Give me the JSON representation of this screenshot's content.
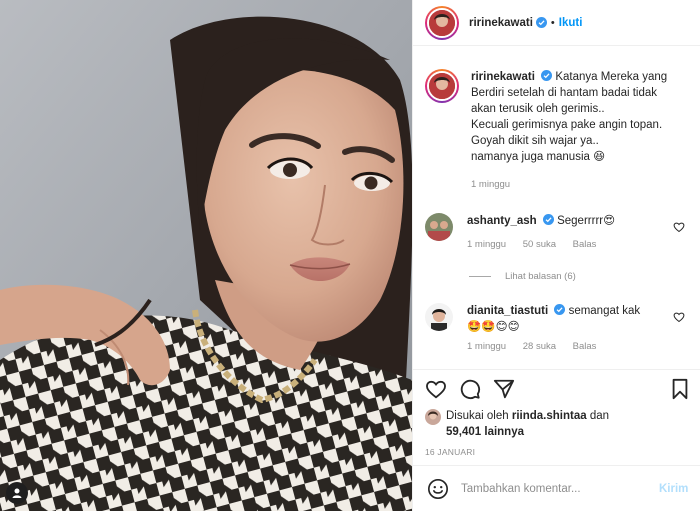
{
  "header": {
    "username": "ririnekawati",
    "separator": "•",
    "follow_label": "Ikuti"
  },
  "caption": {
    "username": "ririnekawati",
    "lines": [
      "Katanya Mereka yang",
      "Berdiri setelah di hantam badai tidak",
      "akan terusik oleh gerimis..",
      "Kecuali gerimisnya pake angin topan.",
      "Goyah dikit sih wajar ya..",
      "namanya juga manusia 😆"
    ],
    "time": "1 minggu"
  },
  "comments": [
    {
      "username": "ashanty_ash",
      "text": "Segerrrrr😍",
      "time": "1 minggu",
      "likes": "50 suka",
      "reply": "Balas",
      "view_replies": "Lihat balasan (6)"
    },
    {
      "username": "dianita_tiastuti",
      "text": "semangat kak",
      "emoji": "🤩🤩😊😊",
      "time": "1 minggu",
      "likes": "28 suka",
      "reply": "Balas"
    }
  ],
  "likes": {
    "prefix": "Disukai oleh",
    "user": "riinda.shintaa",
    "joiner": "dan",
    "count": "59,401 lainnya"
  },
  "date": "16 JANUARI",
  "add_comment": {
    "placeholder": "Tambahkan komentar...",
    "post_label": "Kirim"
  },
  "icons": {
    "verified": "verified-badge-icon",
    "like": "heart-icon",
    "comment": "comment-icon",
    "share": "paper-plane-icon",
    "save": "bookmark-icon",
    "emoji": "smiley-icon",
    "photo_tag": "user-tag-icon"
  },
  "colors": {
    "link_blue": "#0095f6",
    "verified_blue": "#3897f0",
    "muted_text": "#8e8e8e",
    "post_disabled": "#b2dffc"
  }
}
